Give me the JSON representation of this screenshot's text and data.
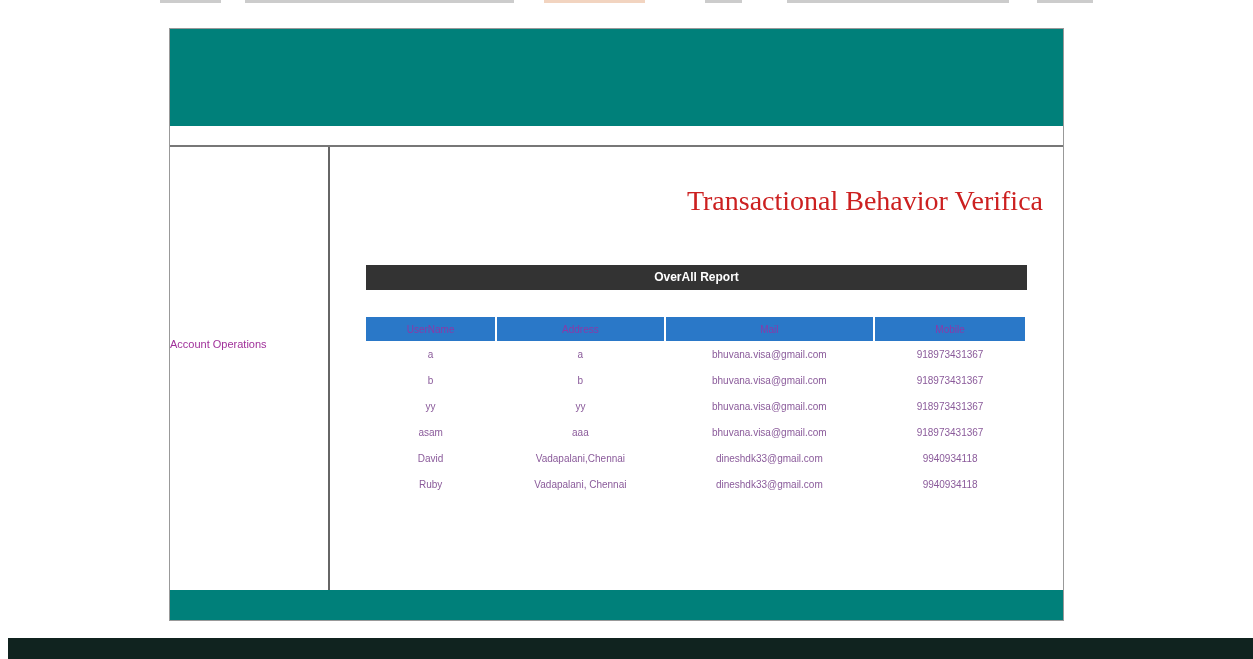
{
  "title": "Transactional Behavior Verifica",
  "sidebar": {
    "items": [
      {
        "label": "Account Operations"
      }
    ]
  },
  "report": {
    "heading": "OverAll Report",
    "columns": [
      "UserName",
      "Address",
      "Mail",
      "Mobile"
    ],
    "rows": [
      [
        "a",
        "a",
        "bhuvana.visa@gmail.com",
        "918973431367"
      ],
      [
        "b",
        "b",
        "bhuvana.visa@gmail.com",
        "918973431367"
      ],
      [
        "yy",
        "yy",
        "bhuvana.visa@gmail.com",
        "918973431367"
      ],
      [
        "asam",
        "aaa",
        "bhuvana.visa@gmail.com",
        "918973431367"
      ],
      [
        "David",
        "Vadapalani,Chennai",
        "dineshdk33@gmail.com",
        "9940934118"
      ],
      [
        "Ruby",
        "Vadapalani, Chennai",
        "dineshdk33@gmail.com",
        "9940934118"
      ]
    ]
  }
}
